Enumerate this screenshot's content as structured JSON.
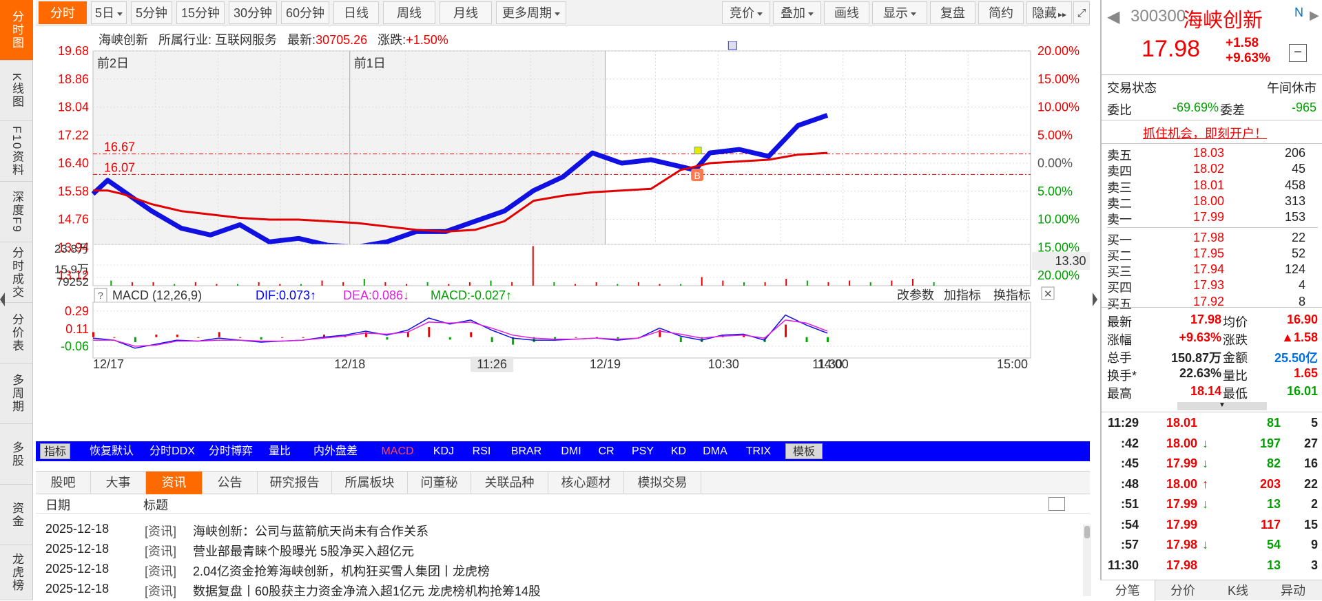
{
  "left_tabs": [
    {
      "label": "分时图",
      "active": true
    },
    {
      "label": "K线图",
      "active": false
    },
    {
      "label": "F10资料",
      "active": false
    },
    {
      "label": "深度F9",
      "active": false
    },
    {
      "label": "分时成交",
      "active": false
    },
    {
      "label": "分价表",
      "active": false
    },
    {
      "label": "多周期",
      "active": false
    },
    {
      "label": "多股",
      "active": false
    },
    {
      "label": "资金",
      "active": false
    },
    {
      "label": "龙虎榜",
      "active": false
    }
  ],
  "toolbar": {
    "period_tabs": [
      {
        "label": "分时",
        "active": true
      },
      {
        "label": "5日",
        "dropdown": true
      },
      {
        "label": "5分钟"
      },
      {
        "label": "15分钟"
      },
      {
        "label": "30分钟"
      },
      {
        "label": "60分钟"
      },
      {
        "label": "日线"
      },
      {
        "label": "周线"
      },
      {
        "label": "月线"
      },
      {
        "label": "更多周期",
        "dropdown": true
      }
    ],
    "right_tools": [
      {
        "label": "竞价",
        "dropdown": true
      },
      {
        "label": "叠加",
        "dropdown": true
      },
      {
        "label": "画线"
      },
      {
        "label": "显示",
        "dropdown": true
      },
      {
        "label": "复盘"
      },
      {
        "label": "简约"
      },
      {
        "label": "隐藏"
      }
    ],
    "expand_icon": "expand-icon"
  },
  "info_bar": {
    "name": "海峡创新",
    "industry_label": "所属行业:",
    "industry": "互联网服务",
    "latest_label": "最新:",
    "latest": "30705.26",
    "change_label": "涨跌:",
    "change": "+1.50%"
  },
  "chart_data": [
    {
      "type": "line",
      "title": "",
      "day_labels": [
        "前2日",
        "前1日"
      ],
      "y_ticks_left": [
        "19.68",
        "18.86",
        "18.04",
        "17.22",
        "16.40",
        "15.58",
        "14.76",
        "13.94",
        "13.12"
      ],
      "y_ticks_right": [
        "20.00%",
        "15.00%",
        "10.00%",
        "5.00%",
        "0.00%",
        "5.00%",
        "10.00%",
        "15.00%",
        "20.00%"
      ],
      "ylim": [
        13.12,
        19.68
      ],
      "ref_lines": [
        "16.67",
        "16.07"
      ],
      "right_badge": "13.30",
      "markers": [
        "B"
      ],
      "x_labels": [
        "12/17",
        "12/18",
        "11:26",
        "12/19",
        "10:30",
        "11:30",
        "14:00",
        "15:00"
      ],
      "series": [
        {
          "color": "#1010e0",
          "x": [
            0,
            0.05,
            0.1,
            0.2,
            0.3,
            0.4,
            0.5,
            0.6,
            0.7,
            0.8,
            0.9,
            1.0,
            1.1,
            1.2,
            1.3,
            1.4,
            1.5,
            1.6,
            1.7,
            1.8,
            1.9,
            2.0,
            2.05,
            2.1,
            2.2,
            2.3,
            2.4,
            2.5
          ],
          "values": [
            15.5,
            15.9,
            15.6,
            15.0,
            14.5,
            14.3,
            14.6,
            14.1,
            14.2,
            14.0,
            13.95,
            14.1,
            14.4,
            14.4,
            14.7,
            15.0,
            15.6,
            16.0,
            16.7,
            16.4,
            16.5,
            16.3,
            16.2,
            16.7,
            16.8,
            16.6,
            17.5,
            17.8
          ]
        },
        {
          "color": "#e00000",
          "x": [
            0,
            0.05,
            0.1,
            0.2,
            0.3,
            0.4,
            0.5,
            0.6,
            0.7,
            0.8,
            0.9,
            1.0,
            1.1,
            1.2,
            1.3,
            1.4,
            1.5,
            1.6,
            1.7,
            1.8,
            1.9,
            2.0,
            2.05,
            2.1,
            2.2,
            2.3,
            2.4,
            2.5
          ],
          "values": [
            15.6,
            15.6,
            15.5,
            15.2,
            15.0,
            14.9,
            14.8,
            14.75,
            14.75,
            14.7,
            14.65,
            14.55,
            14.45,
            14.4,
            14.45,
            14.7,
            15.3,
            15.45,
            15.55,
            15.6,
            15.65,
            16.2,
            16.3,
            16.4,
            16.45,
            16.5,
            16.65,
            16.7
          ]
        }
      ]
    },
    {
      "type": "bar",
      "title": "",
      "y_ticks": [
        "23.8万",
        "15.9万",
        "79252"
      ],
      "values": [
        3,
        2,
        2,
        1,
        2,
        1,
        1,
        2,
        1,
        1,
        3,
        2,
        4,
        2,
        1,
        2,
        1,
        2,
        3,
        2,
        23,
        2,
        1,
        2,
        1,
        2,
        1,
        1,
        5,
        3,
        2,
        2,
        4,
        3,
        2,
        3,
        2,
        3,
        4,
        2
      ]
    },
    {
      "type": "line",
      "title": "MACD (12,26,9)",
      "legend": [
        "DIF:0.073↑",
        "DEA:0.086↓",
        "MACD:-0.027↑"
      ],
      "y_ticks": [
        "0.29",
        "0.11",
        "-0.06"
      ],
      "ylim": [
        -0.15,
        0.35
      ],
      "actions": [
        "改参数",
        "加指标",
        "换指标"
      ],
      "series": [
        {
          "name": "DIF",
          "color": "#1010e0",
          "values": [
            0.02,
            0.0,
            -0.08,
            -0.04,
            0.0,
            -0.01,
            0.02,
            0.0,
            -0.02,
            -0.01,
            0.0,
            0.03,
            0.05,
            0.09,
            0.05,
            0.1,
            0.22,
            0.16,
            0.2,
            0.1,
            0.02,
            0.0,
            0.0,
            0.01,
            0.02,
            0.0,
            0.02,
            0.12,
            0.04,
            0.0,
            0.05,
            0.06,
            0.0,
            0.25,
            0.15,
            0.07
          ]
        },
        {
          "name": "DEA",
          "color": "#e020e0",
          "values": [
            0.0,
            0.0,
            -0.06,
            -0.05,
            -0.01,
            -0.01,
            0.0,
            0.0,
            -0.01,
            -0.01,
            0.0,
            0.02,
            0.04,
            0.07,
            0.06,
            0.08,
            0.18,
            0.17,
            0.18,
            0.12,
            0.05,
            0.02,
            0.01,
            0.01,
            0.02,
            0.01,
            0.02,
            0.09,
            0.06,
            0.02,
            0.04,
            0.05,
            0.02,
            0.2,
            0.17,
            0.09
          ]
        }
      ]
    }
  ],
  "indicator_tabs": [
    {
      "label": "指标",
      "style": "boxed"
    },
    {
      "label": "恢复默认"
    },
    {
      "label": "分时DDX"
    },
    {
      "label": "分时博弈"
    },
    {
      "label": "量比"
    },
    {
      "label": "内外盘差"
    },
    {
      "label": "MACD",
      "style": "hl"
    },
    {
      "label": "KDJ"
    },
    {
      "label": "RSI"
    },
    {
      "label": "BRAR"
    },
    {
      "label": "DMI"
    },
    {
      "label": "CR"
    },
    {
      "label": "PSY"
    },
    {
      "label": "KD"
    },
    {
      "label": "DMA"
    },
    {
      "label": "TRIX"
    },
    {
      "label": "模板",
      "style": "boxed"
    }
  ],
  "news_tabs": [
    {
      "label": "股吧"
    },
    {
      "label": "大事"
    },
    {
      "label": "资讯",
      "active": true
    },
    {
      "label": "公告"
    },
    {
      "label": "研究报告"
    },
    {
      "label": "所属板块"
    },
    {
      "label": "问董秘"
    },
    {
      "label": "关联品种"
    },
    {
      "label": "核心题材"
    },
    {
      "label": "模拟交易"
    }
  ],
  "news_header": {
    "date": "日期",
    "title": "标题"
  },
  "news": [
    {
      "date": "2025-12-18",
      "tag": "[资讯]",
      "title": "海峡创新：公司与蓝箭航天尚未有合作关系"
    },
    {
      "date": "2025-12-18",
      "tag": "[资讯]",
      "title": "营业部最青睐个股曝光 5股净买入超亿元"
    },
    {
      "date": "2025-12-18",
      "tag": "[资讯]",
      "title": "2.04亿资金抢筹海峡创新，机构狂买雪人集团丨龙虎榜"
    },
    {
      "date": "2025-12-18",
      "tag": "[资讯]",
      "title": "数据复盘丨60股获主力资金净流入超1亿元 龙虎榜机构抢筹14股"
    }
  ],
  "quote": {
    "code": "300300",
    "name": "海峡创新",
    "price": "17.98",
    "change": "+1.58",
    "change_pct": "+9.63%",
    "status_label": "交易状态",
    "status": "午间休市",
    "wb_label": "委比",
    "wb": "-69.69%",
    "wc_label": "委差",
    "wc": "-965",
    "promo": "抓住机会，即刻开户！",
    "asks": [
      {
        "label": "卖五",
        "price": "18.03",
        "vol": "206"
      },
      {
        "label": "卖四",
        "price": "18.02",
        "vol": "45"
      },
      {
        "label": "卖三",
        "price": "18.01",
        "vol": "458"
      },
      {
        "label": "卖二",
        "price": "18.00",
        "vol": "313"
      },
      {
        "label": "卖一",
        "price": "17.99",
        "vol": "153"
      }
    ],
    "bids": [
      {
        "label": "买一",
        "price": "17.98",
        "vol": "22"
      },
      {
        "label": "买二",
        "price": "17.95",
        "vol": "52"
      },
      {
        "label": "买三",
        "price": "17.94",
        "vol": "124"
      },
      {
        "label": "买四",
        "price": "17.93",
        "vol": "4"
      },
      {
        "label": "买五",
        "price": "17.92",
        "vol": "8"
      }
    ],
    "stats": [
      {
        "l1": "最新",
        "v1": "17.98",
        "c1": "red",
        "l2": "均价",
        "v2": "16.90",
        "c2": "red"
      },
      {
        "l1": "涨幅",
        "v1": "+9.63%",
        "c1": "red",
        "l2": "涨跌",
        "v2": "▲1.58",
        "c2": "red"
      },
      {
        "l1": "总手",
        "v1": "150.87万",
        "c1": "dark",
        "l2": "金额",
        "v2": "25.50亿",
        "c2": "blue"
      },
      {
        "l1": "换手*",
        "v1": "22.63%",
        "c1": "dark",
        "l2": "量比",
        "v2": "1.65",
        "c2": "red"
      },
      {
        "l1": "最高",
        "v1": "18.14",
        "c1": "red",
        "l2": "最低",
        "v2": "16.01",
        "c2": "green"
      }
    ],
    "ticks": [
      {
        "time": "11:29",
        "price": "18.01",
        "arrow": "",
        "vol": "81",
        "n": "5",
        "vc": "green"
      },
      {
        "time": ":42",
        "price": "18.00",
        "arrow": "down",
        "vol": "197",
        "n": "27",
        "vc": "green"
      },
      {
        "time": ":45",
        "price": "17.99",
        "arrow": "down",
        "vol": "82",
        "n": "16",
        "vc": "green"
      },
      {
        "time": ":48",
        "price": "18.00",
        "arrow": "up",
        "vol": "203",
        "n": "22",
        "vc": "red"
      },
      {
        "time": ":51",
        "price": "17.99",
        "arrow": "down",
        "vol": "13",
        "n": "2",
        "vc": "green"
      },
      {
        "time": ":54",
        "price": "17.99",
        "arrow": "",
        "vol": "117",
        "n": "15",
        "vc": "red"
      },
      {
        "time": ":57",
        "price": "17.98",
        "arrow": "down",
        "vol": "54",
        "n": "9",
        "vc": "green"
      },
      {
        "time": "11:30",
        "price": "17.98",
        "arrow": "",
        "vol": "13",
        "n": "3",
        "vc": "green"
      }
    ],
    "bottom_tabs": [
      {
        "label": "分笔",
        "active": true
      },
      {
        "label": "分价"
      },
      {
        "label": "K线"
      },
      {
        "label": "异动"
      }
    ]
  }
}
